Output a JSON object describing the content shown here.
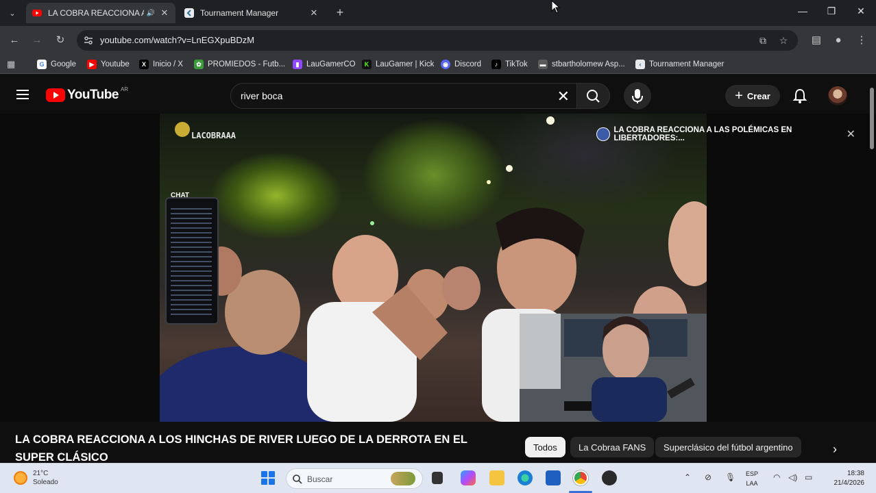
{
  "browser": {
    "tabs": [
      {
        "title": "LA COBRA REACCIONA A L",
        "active": true,
        "favicon": "youtube-icon"
      },
      {
        "title": "Tournament Manager",
        "active": false,
        "favicon": "tournament-icon"
      }
    ],
    "url": "youtube.com/watch?v=LnEGXpuBDzM",
    "bookmarks": [
      {
        "label": "Google",
        "icon": "google-icon",
        "color": "#4285f4"
      },
      {
        "label": "Youtube",
        "icon": "youtube-icon",
        "color": "#ff0000"
      },
      {
        "label": "Inicio / X",
        "icon": "x-icon",
        "color": "#000000"
      },
      {
        "label": "PROMIEDOS - Futb...",
        "icon": "promiedos-icon",
        "color": "#3a9d3a"
      },
      {
        "label": "LauGamerCO",
        "icon": "twitch-icon",
        "color": "#9146ff"
      },
      {
        "label": "LauGamer | Kick",
        "icon": "kick-icon",
        "color": "#53fc18"
      },
      {
        "label": "Discord",
        "icon": "discord-icon",
        "color": "#5865f2"
      },
      {
        "label": "TikTok",
        "icon": "tiktok-icon",
        "color": "#000000"
      },
      {
        "label": "stbartholomew Asp...",
        "icon": "page-icon",
        "color": "#5b5b5b"
      },
      {
        "label": "Tournament Manager",
        "icon": "tournament-icon",
        "color": "#e8eaed"
      }
    ]
  },
  "youtube": {
    "logo_text": "YouTube",
    "country": "AR",
    "search_query": "river boca",
    "create_label": "Crear",
    "overlay_title": "LA COBRA REACCIONA A LAS POLÉMICAS EN LIBERTADORES:...",
    "video_watermark": "LACOBRAAA",
    "chat_label": "CHAT",
    "video_title": "LA COBRA REACCIONA A LOS HINCHAS DE RIVER LUEGO DE LA DERROTA EN EL SUPER CLÁSICO",
    "chips": [
      {
        "label": "Todos",
        "selected": true
      },
      {
        "label": "La Cobraa FANS",
        "selected": false
      },
      {
        "label": "Superclásico del fútbol argentino",
        "selected": false
      }
    ]
  },
  "taskbar": {
    "weather_temp": "21°C",
    "weather_desc": "Soleado",
    "search_placeholder": "Buscar",
    "lang_top": "ESP",
    "lang_bottom": "LAA",
    "time": "18:38",
    "date": "21/4/2026"
  },
  "colors": {
    "youtube_red": "#ff0000",
    "chrome_dark": "#35363a",
    "taskbar": "#dfe6f1"
  }
}
